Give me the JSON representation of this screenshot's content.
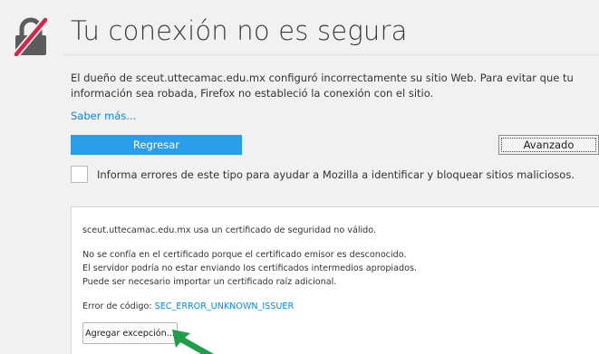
{
  "page": {
    "title": "Tu conexión no es segura",
    "description": "El dueño de sceut.uttecamac.edu.mx configuró incorrectamente su sitio Web. Para evitar que tu información sea robada, Firefox no estableció la conexión con el sitio.",
    "learn_more": "Saber más..."
  },
  "buttons": {
    "back": "Regresar",
    "advanced": "Avanzado",
    "add_exception": "Agregar excepción..."
  },
  "report": {
    "label": "Informa errores de este tipo para ayudar a Mozilla a identificar y bloquear sitios maliciosos.",
    "checked": false
  },
  "advanced_panel": {
    "line1": "sceut.uttecamac.edu.mx usa un certificado de seguridad no válido.",
    "line2": "No se confía en el certificado porque el certificado emisor es desconocido.",
    "line3": "El servidor podría no estar enviando los certificados intermedios apropiados.",
    "line4": "Puede ser necesario importar un certificado raíz adicional.",
    "error_label": "Error de código: ",
    "error_code": "SEC_ERROR_UNKNOWN_ISSUER"
  },
  "icons": {
    "lock": "broken-lock-icon",
    "arrow": "green-arrow-icon"
  },
  "colors": {
    "link": "#0a84ff",
    "primary_button": "#2a9ee8",
    "lock_slash": "#d7264a",
    "arrow": "#1f9e4a"
  }
}
